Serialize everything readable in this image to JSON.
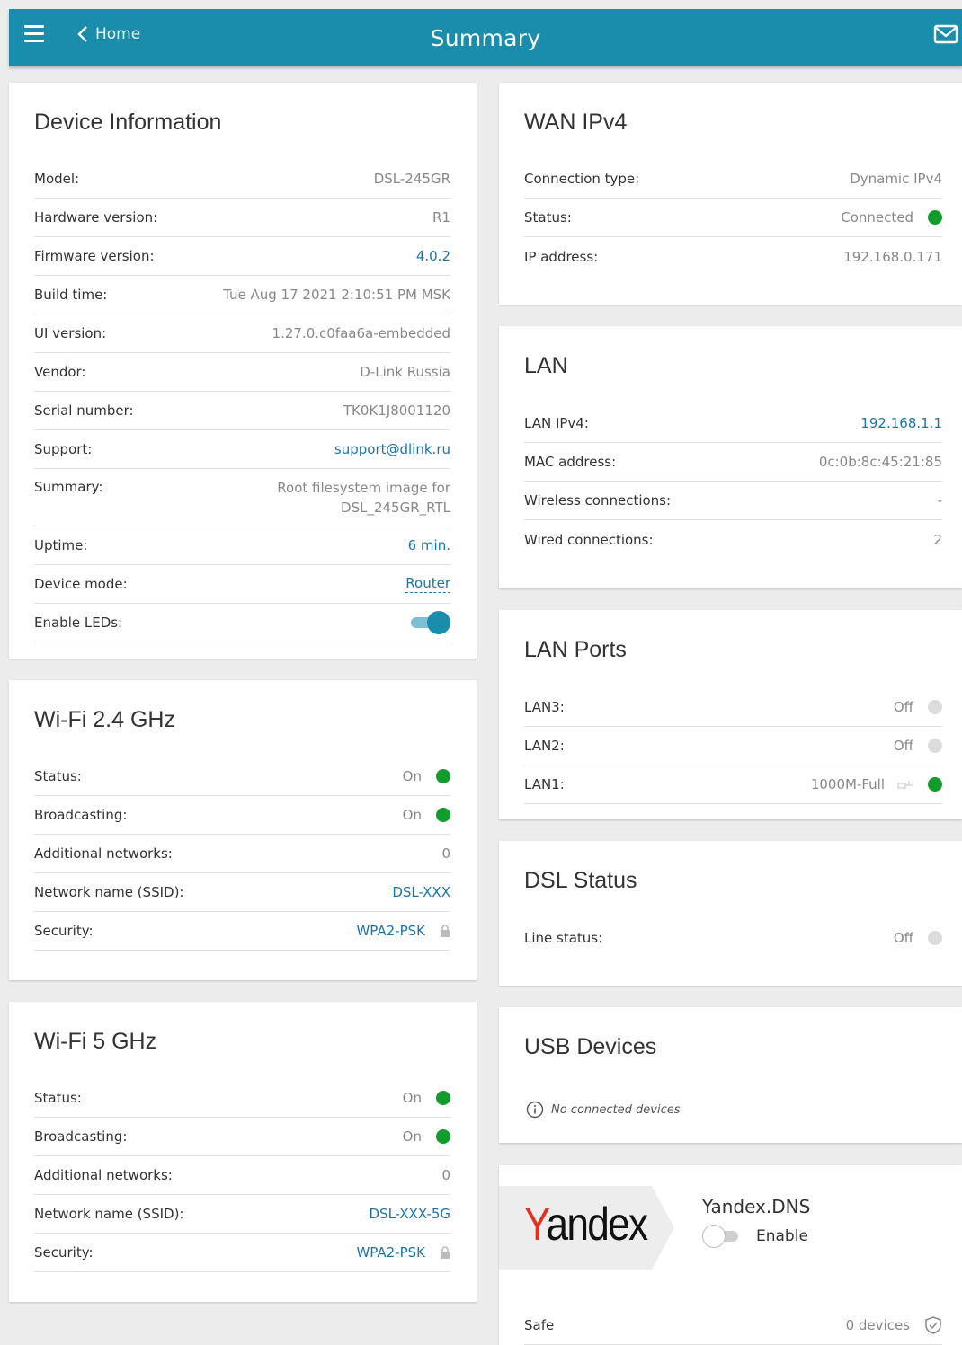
{
  "header": {
    "back_label": "Home",
    "title": "Summary",
    "menu_icon": "hamburger-icon",
    "back_icon": "chevron-left-icon",
    "mail_icon": "mail-icon"
  },
  "colors": {
    "accent": "#1a8dac",
    "link": "#1a76a8",
    "status_on": "#119c2c",
    "status_off": "#dcdcdc",
    "yandex_red": "#e62e1e"
  },
  "device_info": {
    "title": "Device Information",
    "rows": [
      {
        "label": "Model:",
        "value": "DSL-245GR"
      },
      {
        "label": "Hardware version:",
        "value": "R1"
      },
      {
        "label": "Firmware version:",
        "value": "4.0.2"
      },
      {
        "label": "Build time:",
        "value": "Tue Aug 17 2021 2:10:51 PM MSK"
      },
      {
        "label": "UI version:",
        "value": "1.27.0.c0faa6a-embedded"
      },
      {
        "label": "Vendor:",
        "value": "D-Link Russia"
      },
      {
        "label": "Serial number:",
        "value": "TK0K1J8001120"
      },
      {
        "label": "Support:",
        "value": "support@dlink.ru"
      },
      {
        "label": "Summary:",
        "value": "Root filesystem image for DSL_245GR_RTL"
      },
      {
        "label": "Uptime:",
        "value": "6 min."
      },
      {
        "label": "Device mode:",
        "value": "Router"
      },
      {
        "label": "Enable LEDs:",
        "value": true
      }
    ]
  },
  "wifi24": {
    "title": "Wi-Fi 2.4 GHz",
    "rows": [
      {
        "label": "Status:",
        "value": "On"
      },
      {
        "label": "Broadcasting:",
        "value": "On"
      },
      {
        "label": "Additional networks:",
        "value": "0"
      },
      {
        "label": "Network name (SSID):",
        "value": "DSL-XXX"
      },
      {
        "label": "Security:",
        "value": "WPA2-PSK"
      }
    ]
  },
  "wifi5": {
    "title": "Wi-Fi 5 GHz",
    "rows": [
      {
        "label": "Status:",
        "value": "On"
      },
      {
        "label": "Broadcasting:",
        "value": "On"
      },
      {
        "label": "Additional networks:",
        "value": "0"
      },
      {
        "label": "Network name (SSID):",
        "value": "DSL-XXX-5G"
      },
      {
        "label": "Security:",
        "value": "WPA2-PSK"
      }
    ]
  },
  "wan": {
    "title": "WAN IPv4",
    "rows": [
      {
        "label": "Connection type:",
        "value": "Dynamic IPv4"
      },
      {
        "label": "Status:",
        "value": "Connected"
      },
      {
        "label": "IP address:",
        "value": "192.168.0.171"
      }
    ]
  },
  "lan": {
    "title": "LAN",
    "rows": [
      {
        "label": "LAN IPv4:",
        "value": "192.168.1.1"
      },
      {
        "label": "MAC address:",
        "value": "0c:0b:8c:45:21:85"
      },
      {
        "label": "Wireless connections:",
        "value": "-"
      },
      {
        "label": "Wired connections:",
        "value": "2"
      }
    ]
  },
  "lan_ports": {
    "title": "LAN Ports",
    "rows": [
      {
        "label": "LAN3:",
        "value": "Off"
      },
      {
        "label": "LAN2:",
        "value": "Off"
      },
      {
        "label": "LAN1:",
        "value": "1000M-Full"
      }
    ]
  },
  "dsl": {
    "title": "DSL Status",
    "rows": [
      {
        "label": "Line status:",
        "value": "Off"
      }
    ]
  },
  "usb": {
    "title": "USB Devices",
    "note": "No connected devices"
  },
  "yandex": {
    "logo_first": "Y",
    "logo_rest": "andex",
    "title": "Yandex.DNS",
    "enable_label": "Enable",
    "enabled": false,
    "rows": [
      {
        "label": "Safe",
        "value": "0 devices"
      }
    ]
  }
}
